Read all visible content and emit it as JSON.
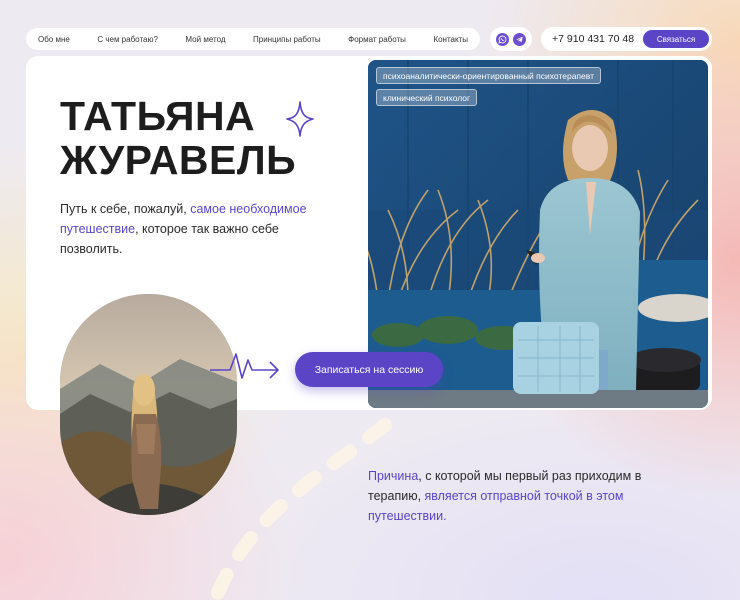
{
  "nav": {
    "items": [
      "Обо мне",
      "С чем работаю?",
      "Мой метод",
      "Принципы работы",
      "Формат работы",
      "Контакты"
    ]
  },
  "social": {
    "icons": [
      "whatsapp-icon",
      "telegram-icon"
    ]
  },
  "contact": {
    "phone": "+7 910 431 70 48",
    "button_label": "Связаться"
  },
  "hero": {
    "name_line1": "ТАТЬЯНА",
    "name_line2": "ЖУРАВЕЛЬ",
    "tagline_1": "Путь к себе, пожалуй, ",
    "tagline_2": "самое необходимое путешествие",
    "tagline_3": ", которое так важно себе позволить.",
    "badge_1": "психоаналитически-ориентированный психотерапевт",
    "badge_2": "клинический психолог",
    "cta_label": "Записаться на сессию"
  },
  "quote": {
    "part_1": "Причина",
    "part_2": ", с которой мы первый раз приходим в терапию, ",
    "part_3": "является отправной точкой в этом путешествии."
  },
  "colors": {
    "accent": "#5b45c6",
    "photo_bg": "#1e4d7c",
    "card": "#ffffff"
  }
}
